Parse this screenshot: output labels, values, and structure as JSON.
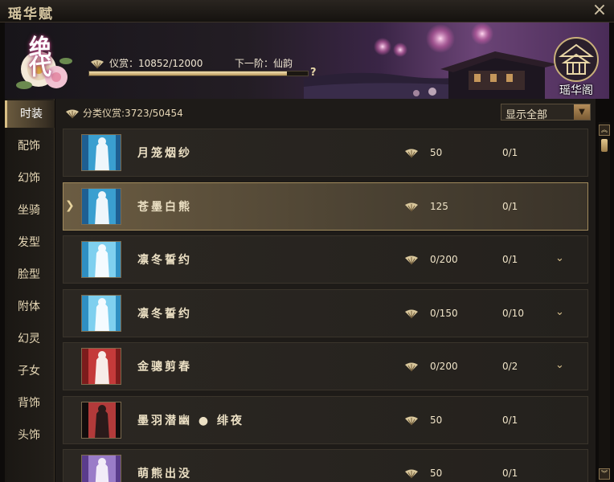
{
  "window": {
    "title": "瑶华赋",
    "close_icon": "×",
    "colors": {
      "accent_gold": "#d8bf85",
      "selected_row": "#6b5c42",
      "background": "#1e1b18"
    }
  },
  "header": {
    "rank_text": "绝代",
    "prestige_label": "仪赏：",
    "prestige_current": 10852,
    "prestige_max": 12000,
    "prestige_value": "10852/12000",
    "next_tier_label": "下一阶：仙韵",
    "help_icon": "?",
    "pavilion_label": "瑶华阁"
  },
  "sidebar": {
    "items": [
      {
        "label": "时装",
        "active": true
      },
      {
        "label": "配饰"
      },
      {
        "label": "幻饰"
      },
      {
        "label": "坐骑"
      },
      {
        "label": "发型"
      },
      {
        "label": "脸型"
      },
      {
        "label": "附体"
      },
      {
        "label": "幻灵"
      },
      {
        "label": "子女"
      },
      {
        "label": "背饰"
      },
      {
        "label": "头饰"
      }
    ]
  },
  "main": {
    "category_label": "分类仪赏",
    "category_value": ":3723/50454",
    "filter": {
      "selected": "显示全部",
      "arrow_icon": "▼"
    },
    "items": [
      {
        "name": "月笼烟纱",
        "prestige": "50",
        "count": "0/1",
        "expandable": false,
        "selected": false,
        "theme": "blue"
      },
      {
        "name": "苍墨白熊",
        "prestige": "125",
        "count": "0/1",
        "expandable": false,
        "selected": true,
        "theme": "blue"
      },
      {
        "name": "凛冬誓约",
        "prestige": "0/200",
        "count": "0/1",
        "expandable": true,
        "selected": false,
        "theme": "ice"
      },
      {
        "name": "凛冬誓约",
        "prestige": "0/150",
        "count": "0/10",
        "expandable": true,
        "selected": false,
        "theme": "ice"
      },
      {
        "name": "金骢剪春",
        "prestige": "0/200",
        "count": "0/2",
        "expandable": true,
        "selected": false,
        "theme": "red"
      },
      {
        "name": "墨羽潜幽 ● 绯夜",
        "prestige": "50",
        "count": "0/1",
        "expandable": false,
        "selected": false,
        "theme": "dark"
      },
      {
        "name": "萌熊出没",
        "prestige": "50",
        "count": "0/1",
        "expandable": false,
        "selected": false,
        "theme": "purple"
      }
    ],
    "expand_icon": "⌄",
    "selected_marker_icon": "❯"
  },
  "scrollbar": {
    "up_icon": "︽",
    "down_icon": "︾"
  }
}
